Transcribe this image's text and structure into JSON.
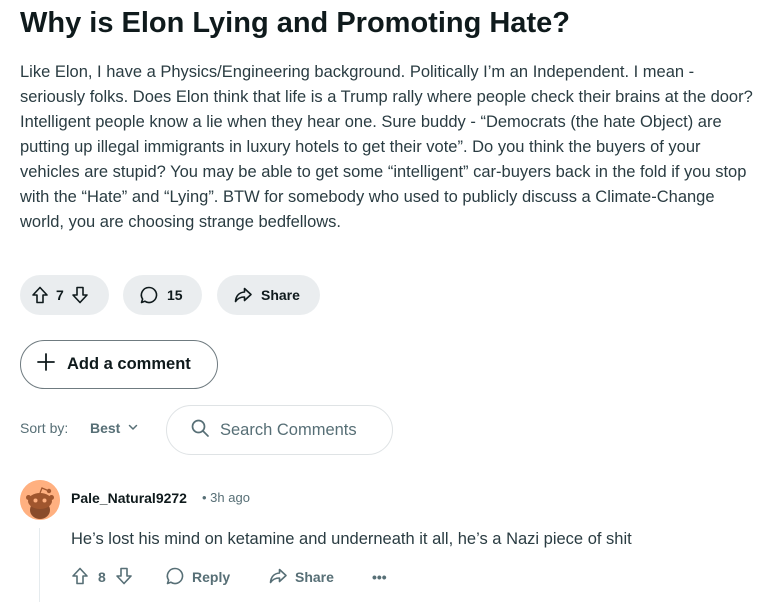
{
  "post": {
    "title": "Why is Elon Lying and Promoting Hate?",
    "body": "Like Elon, I have a Physics/Engineering background. Politically I’m an Independent. I mean - seriously folks. Does Elon think that life is a Trump rally where people check their brains at the door? Intelligent people know a lie when they hear one. Sure buddy - “Democrats (the hate Object) are putting up illegal immigrants in luxury hotels to get their vote”. Do you think the buyers of your vehicles are stupid? You may be able to get some “intelligent” car-buyers back in the fold if you stop with the “Hate” and “Lying”. BTW for somebody who used to publicly discuss a Climate-Change world, you are choosing strange bedfellows.",
    "votes": "7",
    "comments_count": "15",
    "share_label": "Share"
  },
  "add_comment_label": "Add a comment",
  "sort": {
    "label": "Sort by:",
    "value": "Best"
  },
  "search": {
    "placeholder": "Search Comments"
  },
  "comments": [
    {
      "author": "Pale_Natural9272",
      "meta": "• 3h ago",
      "text": "He’s lost his mind on ketamine and underneath it all, he’s a Nazi piece of shit",
      "votes": "8",
      "reply_label": "Reply",
      "share_label": "Share",
      "more_label": "•••"
    }
  ],
  "colors": {
    "pill_bg": "#eaedef",
    "muted_text": "#576f76",
    "avatar_bg": "#ffb080"
  },
  "icons": [
    "upvote-icon",
    "downvote-icon",
    "comment-icon",
    "share-icon",
    "plus-icon",
    "chevron-down-icon",
    "search-icon",
    "avatar-snoo-icon"
  ]
}
